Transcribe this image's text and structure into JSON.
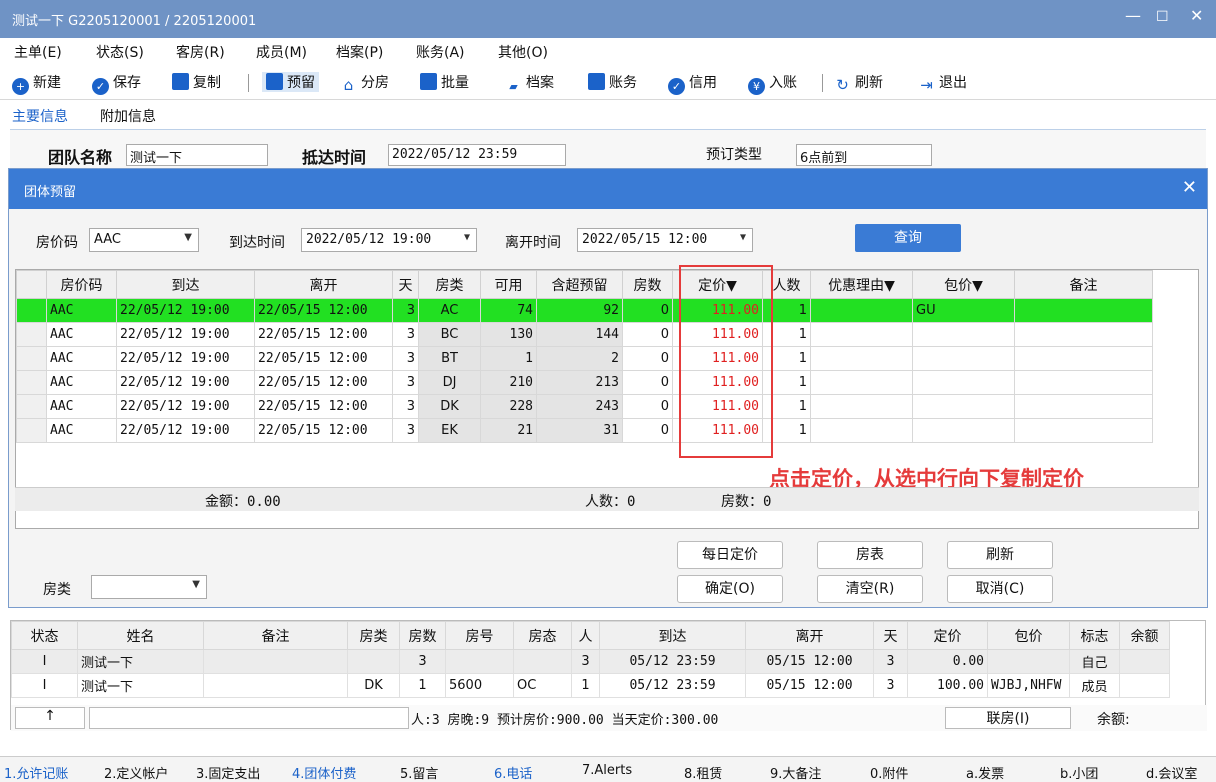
{
  "window": {
    "title": "测试一下  G2205120001 / 2205120001",
    "min": "—",
    "max": "☐",
    "close": "✕"
  },
  "menu": [
    "主单(E)",
    "状态(S)",
    "客房(R)",
    "成员(M)",
    "档案(P)",
    "账务(A)",
    "其他(O)"
  ],
  "toolbar": {
    "new": "新建",
    "save": "保存",
    "copy": "复制",
    "reserve": "预留",
    "assign": "分房",
    "batch": "批量",
    "profile": "档案",
    "account": "账务",
    "credit": "信用",
    "post": "入账",
    "refresh": "刷新",
    "exit": "退出"
  },
  "tabs": {
    "main": "主要信息",
    "extra": "附加信息"
  },
  "main": {
    "group_label": "团队名称",
    "group_value": "测试一下",
    "arrive_label": "抵达时间",
    "arrive_value": "2022/05/12 23:59",
    "type_label": "预订类型",
    "type_value": "6点前到"
  },
  "dialog": {
    "title": "团体预留",
    "rate_code_label": "房价码",
    "rate_code_value": "AAC",
    "arrive_label": "到达时间",
    "arrive_value": "2022/05/12 19:00",
    "depart_label": "离开时间",
    "depart_value": "2022/05/15 12:00",
    "query": "查询",
    "columns": [
      "房价码",
      "到达",
      "离开",
      "天",
      "房类",
      "可用",
      "含超预留",
      "房数",
      "定价▼",
      "人数",
      "优惠理由▼",
      "包价▼",
      "备注"
    ],
    "rows": [
      {
        "code": "AAC",
        "arrive": "22/05/12 19:00",
        "depart": "22/05/15 12:00",
        "days": "3",
        "type": "AC",
        "avail": "74",
        "over": "92",
        "rooms": "0",
        "price": "111.00",
        "persons": "1",
        "reason": "",
        "pkg": "GU",
        "note": ""
      },
      {
        "code": "AAC",
        "arrive": "22/05/12 19:00",
        "depart": "22/05/15 12:00",
        "days": "3",
        "type": "BC",
        "avail": "130",
        "over": "144",
        "rooms": "0",
        "price": "111.00",
        "persons": "1",
        "reason": "",
        "pkg": "",
        "note": ""
      },
      {
        "code": "AAC",
        "arrive": "22/05/12 19:00",
        "depart": "22/05/15 12:00",
        "days": "3",
        "type": "BT",
        "avail": "1",
        "over": "2",
        "rooms": "0",
        "price": "111.00",
        "persons": "1",
        "reason": "",
        "pkg": "",
        "note": ""
      },
      {
        "code": "AAC",
        "arrive": "22/05/12 19:00",
        "depart": "22/05/15 12:00",
        "days": "3",
        "type": "DJ",
        "avail": "210",
        "over": "213",
        "rooms": "0",
        "price": "111.00",
        "persons": "1",
        "reason": "",
        "pkg": "",
        "note": ""
      },
      {
        "code": "AAC",
        "arrive": "22/05/12 19:00",
        "depart": "22/05/15 12:00",
        "days": "3",
        "type": "DK",
        "avail": "228",
        "over": "243",
        "rooms": "0",
        "price": "111.00",
        "persons": "1",
        "reason": "",
        "pkg": "",
        "note": ""
      },
      {
        "code": "AAC",
        "arrive": "22/05/12 19:00",
        "depart": "22/05/15 12:00",
        "days": "3",
        "type": "EK",
        "avail": "21",
        "over": "31",
        "rooms": "0",
        "price": "111.00",
        "persons": "1",
        "reason": "",
        "pkg": "",
        "note": ""
      }
    ],
    "annotation": "点击定价，从选中行向下复制定价",
    "sum_amount": "金额：0.00",
    "sum_persons": "人数：0",
    "sum_rooms": "房数：0",
    "room_type_label": "房类",
    "btn_daily": "每日定价",
    "btn_roomlist": "房表",
    "btn_refresh": "刷新",
    "btn_ok": "确定(O)",
    "btn_clear": "清空(R)",
    "btn_cancel": "取消(C)"
  },
  "lower": {
    "columns": [
      "状态",
      "姓名",
      "备注",
      "房类",
      "房数",
      "房号",
      "房态",
      "人",
      "到达",
      "离开",
      "天",
      "定价",
      "包价",
      "标志",
      "余额"
    ],
    "rows": [
      [
        "I",
        "测试一下",
        "",
        "",
        "3",
        "",
        "",
        "3",
        "05/12 23:59",
        "05/15 12:00",
        "3",
        "0.00",
        "",
        "自己",
        ""
      ],
      [
        "I",
        "测试一下",
        "",
        "DK",
        "1",
        "5600",
        "OC",
        "1",
        "05/12 23:59",
        "05/15 12:00",
        "3",
        "100.00",
        "WJBJ,NHFW",
        "成员",
        ""
      ]
    ],
    "up": "↑",
    "summary": "人:3  房晚:9  预计房价:900.00  当天定价:300.00",
    "link": "联房(I)",
    "balance": "余额:"
  },
  "statusbar": [
    "1.允许记账",
    "2.定义帐户",
    "3.固定支出",
    "4.团体付费",
    "5.留言",
    "6.电话",
    "7.Alerts",
    "8.租赁",
    "9.大备注",
    "0.附件",
    "a.发票",
    "b.小团",
    "d.会议室"
  ]
}
